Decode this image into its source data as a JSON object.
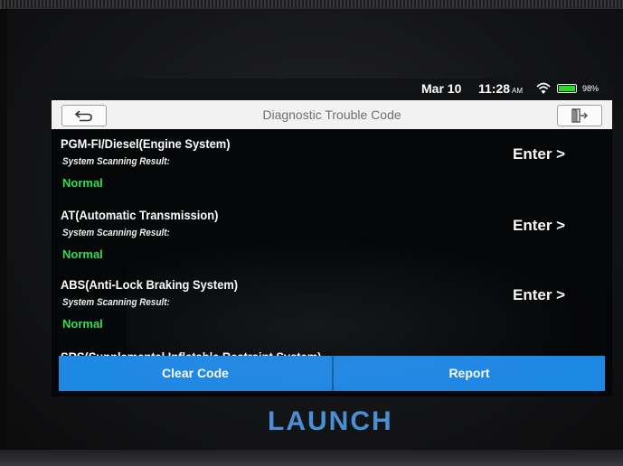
{
  "status_bar": {
    "date": "Mar 10",
    "time": "11:28",
    "ampm": "AM",
    "battery": "98%",
    "battery_color": "#22dd22"
  },
  "header": {
    "title": "Diagnostic Trouble Code",
    "back_icon": "back-arrow-icon",
    "exit_icon": "exit-icon"
  },
  "systems": [
    {
      "name": "PGM-FI/Diesel(Engine System)",
      "label": "System Scanning Result:",
      "result": "Normal",
      "action": "Enter >"
    },
    {
      "name": "AT(Automatic Transmission)",
      "label": "System Scanning Result:",
      "result": "Normal",
      "action": "Enter >"
    },
    {
      "name": "ABS(Anti-Lock Braking System)",
      "label": "System Scanning Result:",
      "result": "Normal",
      "action": "Enter >"
    }
  ],
  "partial_item": "SRS(Supplemental Inflatable Restraint System)",
  "buttons": {
    "clear": "Clear Code",
    "report": "Report"
  },
  "brand": "LAUNCH",
  "colors": {
    "accent": "#1e88e5",
    "normal": "#2fe04a",
    "brand": "#4a8fd6"
  }
}
